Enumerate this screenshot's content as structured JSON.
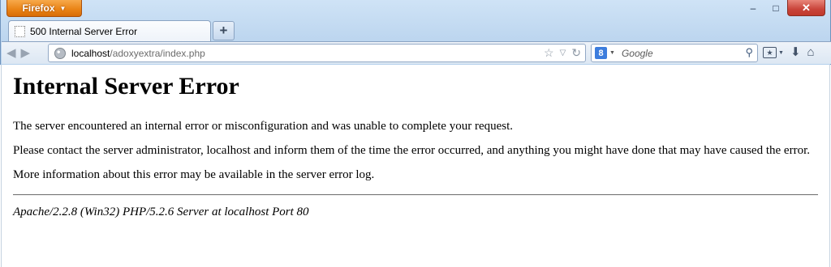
{
  "browser": {
    "menu_label": "Firefox",
    "window_controls": {
      "minimize": "–",
      "maximize": "□",
      "close": "✕"
    },
    "tab": {
      "title": "500 Internal Server Error"
    },
    "new_tab_label": "+",
    "url": {
      "host": "localhost",
      "path": "/adoxyextra/index.php"
    },
    "search": {
      "engine_letter": "8",
      "placeholder": "Google"
    }
  },
  "page": {
    "heading": "Internal Server Error",
    "paragraph1": "The server encountered an internal error or misconfiguration and was unable to complete your request.",
    "paragraph2": "Please contact the server administrator, localhost and inform them of the time the error occurred, and anything you might have done that may have caused the error.",
    "paragraph3": "More information about this error may be available in the server error log.",
    "server_signature": "Apache/2.2.8 (Win32) PHP/5.2.6 Server at localhost Port 80"
  },
  "colors": {
    "firefox_button": "#ea8518",
    "close_button": "#c9443a",
    "chrome_background": "#bdd6ef"
  },
  "icons": [
    "back-icon",
    "forward-icon",
    "globe-icon",
    "bookmark-star-icon",
    "history-dropdown-icon",
    "reload-icon",
    "google-icon",
    "search-icon",
    "bookmarks-menu-icon",
    "downloads-icon",
    "home-icon"
  ]
}
